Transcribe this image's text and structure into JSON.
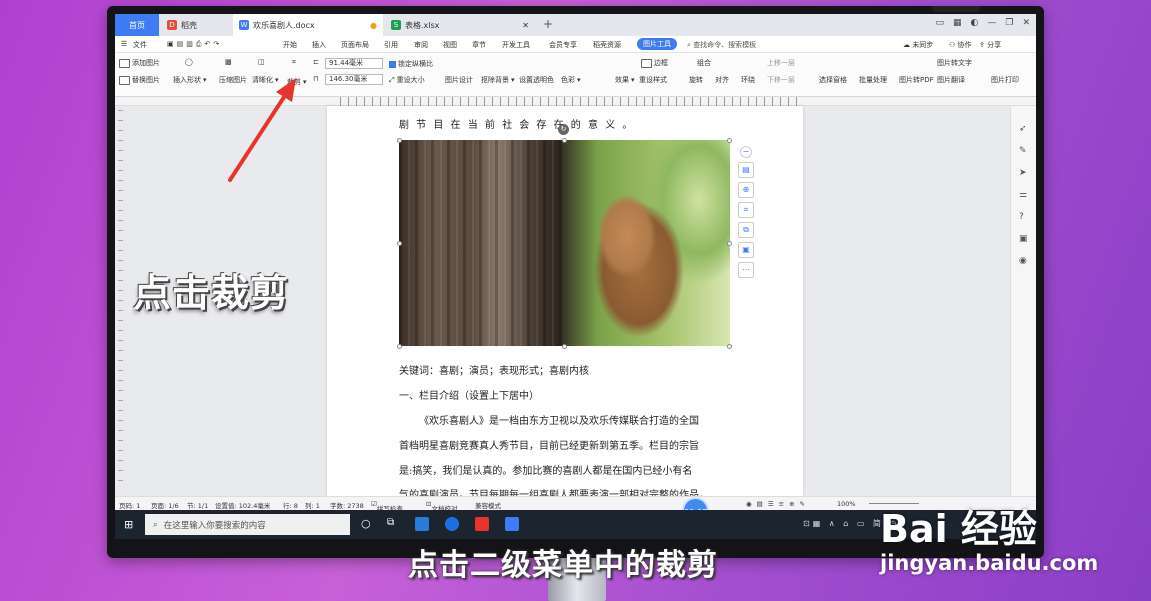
{
  "tabs": {
    "home": "首页",
    "doc": "稻壳",
    "active_doc": "欢乐喜剧人.docx",
    "xlsx": "表格.xlsx"
  },
  "menubar": {
    "file": "文件",
    "items": [
      "开始",
      "插入",
      "页面布局",
      "引用",
      "审阅",
      "视图",
      "章节",
      "开发工具",
      "会员专享",
      "稻壳资源"
    ],
    "picture_tools": "图片工具",
    "search": "查找命令、搜索模板",
    "sync": "未同步",
    "collab": "协作",
    "share": "分享"
  },
  "ribbon": {
    "add_pic": "添加图片",
    "replace_pic": "替换图片",
    "insert_shape": "插入形状",
    "compress": "压缩图片",
    "sharpen": "清晰化",
    "crop": "裁剪",
    "width": "91.44毫米",
    "height": "146.30毫米",
    "lock_ratio": "锁定纵横比",
    "reset_size": "重设大小",
    "pic_design": "图片设计",
    "cutout": "抠除背景",
    "transparent": "设置透明色",
    "color": "色彩",
    "effect": "效果",
    "reset_style": "重设样式",
    "border": "边框",
    "combine": "组合",
    "rotate": "旋转",
    "align": "对齐",
    "wrap": "环绕",
    "up_layer": "上移一层",
    "down_layer": "下移一层",
    "select_pane": "选择窗格",
    "batch": "批量处理",
    "pic_to_pdf": "图片转PDF",
    "pic_to_text": "图片转文字",
    "pic_translate": "图片翻译",
    "pic_print": "图片打印"
  },
  "document": {
    "line1": "剧 节 目 在 当 前 社 会 存 在 的 意 义 。",
    "keywords": "关键词：喜剧；演员；表现形式；喜剧内核",
    "section": "一、栏目介绍（设置上下居中）",
    "para1": "《欢乐喜剧人》是一档由东方卫视以及欢乐传媒联合打造的全国",
    "para2": "首档明星喜剧竞赛真人秀节目，目前已经更新到第五季。栏目的宗旨",
    "para3": "是:搞笑，我们是认真的。参加比赛的喜剧人都是在国内已经小有名",
    "para4": "气的喜剧演员。节目每期每一组喜剧人都要表演一部相对完整的作品，"
  },
  "status": {
    "page": "页码: 1",
    "pages": "页面: 1/6",
    "section": "节: 1/1",
    "setting": "设置值: 102.4毫米",
    "row": "行: 8",
    "col": "列: 1",
    "words": "字数: 2738",
    "spell": "拼写检查",
    "proof": "文档校对",
    "compat": "兼容模式",
    "zoom": "100%"
  },
  "timer": "00:07",
  "taskbar": {
    "search": "在这里输入你要搜索的内容"
  },
  "overlay": "点击裁剪",
  "subtitle": "点击二级菜单中的裁剪",
  "watermark": "Bai 经验",
  "watermark_url": "jingyan.baidu.com",
  "colors": {
    "accent": "#3f7bf2",
    "arrow": "#e8342e"
  }
}
